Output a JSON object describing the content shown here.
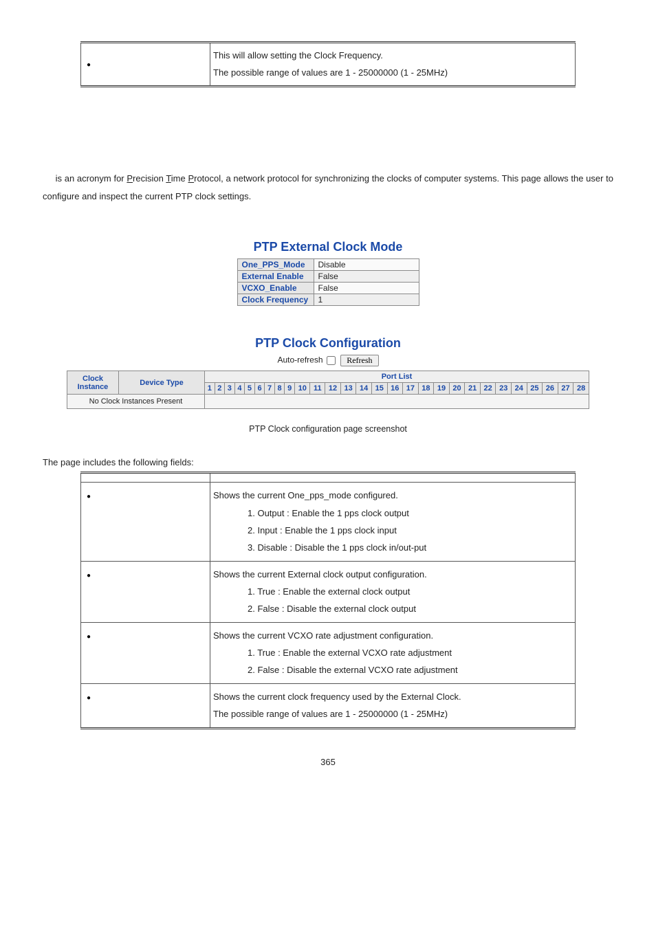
{
  "top_table": {
    "row": {
      "desc_line1": "This will allow setting the Clock Frequency.",
      "desc_line2": "The possible range of values are 1 - 25000000 (1 - 25MHz)"
    }
  },
  "intro_paragraph": {
    "prefix": " is an acronym for ",
    "p_letter": "P",
    "p_rest": "recision ",
    "t_letter": "T",
    "t_rest": "ime ",
    "p2_letter": "P",
    "p2_rest": "rotocol, a network protocol for synchronizing the clocks of computer systems. This page allows the user to configure and inspect the current PTP clock settings."
  },
  "screenshot1": {
    "title": "PTP External Clock Mode",
    "rows": [
      {
        "label": "One_PPS_Mode",
        "value": "Disable"
      },
      {
        "label": "External Enable",
        "value": "False"
      },
      {
        "label": "VCXO_Enable",
        "value": "False"
      },
      {
        "label": "Clock Frequency",
        "value": "1"
      }
    ]
  },
  "screenshot2": {
    "title": "PTP Clock Configuration",
    "auto_refresh_label": "Auto-refresh",
    "refresh_button": "Refresh",
    "headers": {
      "clock_instance": "Clock Instance",
      "device_type": "Device Type",
      "port_list": "Port List"
    },
    "ports": [
      "1",
      "2",
      "3",
      "4",
      "5",
      "6",
      "7",
      "8",
      "9",
      "10",
      "11",
      "12",
      "13",
      "14",
      "15",
      "16",
      "17",
      "18",
      "19",
      "20",
      "21",
      "22",
      "23",
      "24",
      "25",
      "26",
      "27",
      "28"
    ],
    "no_instances": "No Clock Instances Present"
  },
  "caption": "PTP Clock configuration page screenshot",
  "page_includes": "The page includes the following fields:",
  "fields_table": {
    "header_object": "",
    "header_description": "",
    "rows": [
      {
        "lines": [
          "Shows the current One_pps_mode configured.",
          "1. Output : Enable the 1 pps clock output",
          "2. Input : Enable the 1 pps clock input",
          "3. Disable : Disable the 1 pps clock in/out-put"
        ],
        "indented_from": 1
      },
      {
        "lines": [
          "Shows the current External clock output configuration.",
          "1. True : Enable the external clock output",
          "2. False : Disable the external clock output"
        ],
        "indented_from": 1
      },
      {
        "lines": [
          "Shows the current VCXO rate adjustment configuration.",
          "1. True : Enable the external VCXO rate adjustment",
          "2. False : Disable the external VCXO rate adjustment"
        ],
        "indented_from": 1
      },
      {
        "lines": [
          "Shows the current clock frequency used by the External Clock.",
          "The possible range of values are 1 - 25000000 (1 - 25MHz)"
        ],
        "indented_from": 99
      }
    ]
  },
  "page_number": "365"
}
